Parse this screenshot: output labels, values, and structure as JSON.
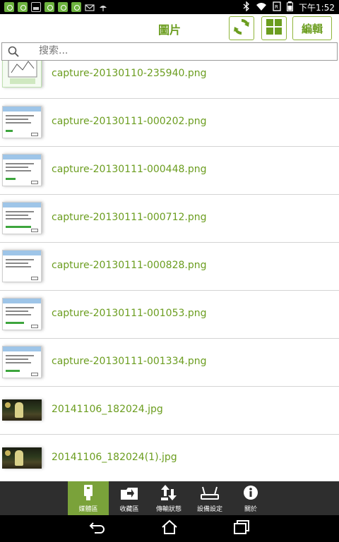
{
  "status_bar": {
    "time": "下午1:52",
    "notification_icons": [
      "app-notification-icon",
      "app-notification-icon",
      "image-notification-icon",
      "app-notification-icon",
      "app-notification-icon",
      "app-notification-icon",
      "mail-icon",
      "weather-icon"
    ],
    "system_icons": [
      "bluetooth-icon",
      "wifi-icon",
      "sim-icon",
      "battery-icon"
    ]
  },
  "action_bar": {
    "title": "圖片",
    "edit_label": "編輯",
    "accent_color": "#6b9d1f"
  },
  "search": {
    "placeholder": "搜索..."
  },
  "files": [
    {
      "name": "capture-20130110-235940.png",
      "thumb": "drawing"
    },
    {
      "name": "capture-20130111-000202.png",
      "thumb": "screenshot"
    },
    {
      "name": "capture-20130111-000448.png",
      "thumb": "screenshot"
    },
    {
      "name": "capture-20130111-000712.png",
      "thumb": "screenshot"
    },
    {
      "name": "capture-20130111-000828.png",
      "thumb": "screenshot"
    },
    {
      "name": "capture-20130111-001053.png",
      "thumb": "screenshot"
    },
    {
      "name": "capture-20130111-001334.png",
      "thumb": "screenshot"
    },
    {
      "name": "20141106_182024.jpg",
      "thumb": "photo"
    },
    {
      "name": "20141106_182024(1).jpg",
      "thumb": "photo"
    }
  ],
  "bottom_tabs": [
    {
      "label": "媒體區",
      "icon": "usb-device-icon",
      "active": true
    },
    {
      "label": "收藏區",
      "icon": "folder-download-icon",
      "active": false
    },
    {
      "label": "傳輸狀態",
      "icon": "transfer-arrows-icon",
      "active": false
    },
    {
      "label": "設備設定",
      "icon": "router-icon",
      "active": false
    },
    {
      "label": "關於",
      "icon": "info-icon",
      "active": false
    }
  ],
  "nav_bar": {
    "buttons": [
      "back-icon",
      "home-icon",
      "recents-icon"
    ]
  }
}
